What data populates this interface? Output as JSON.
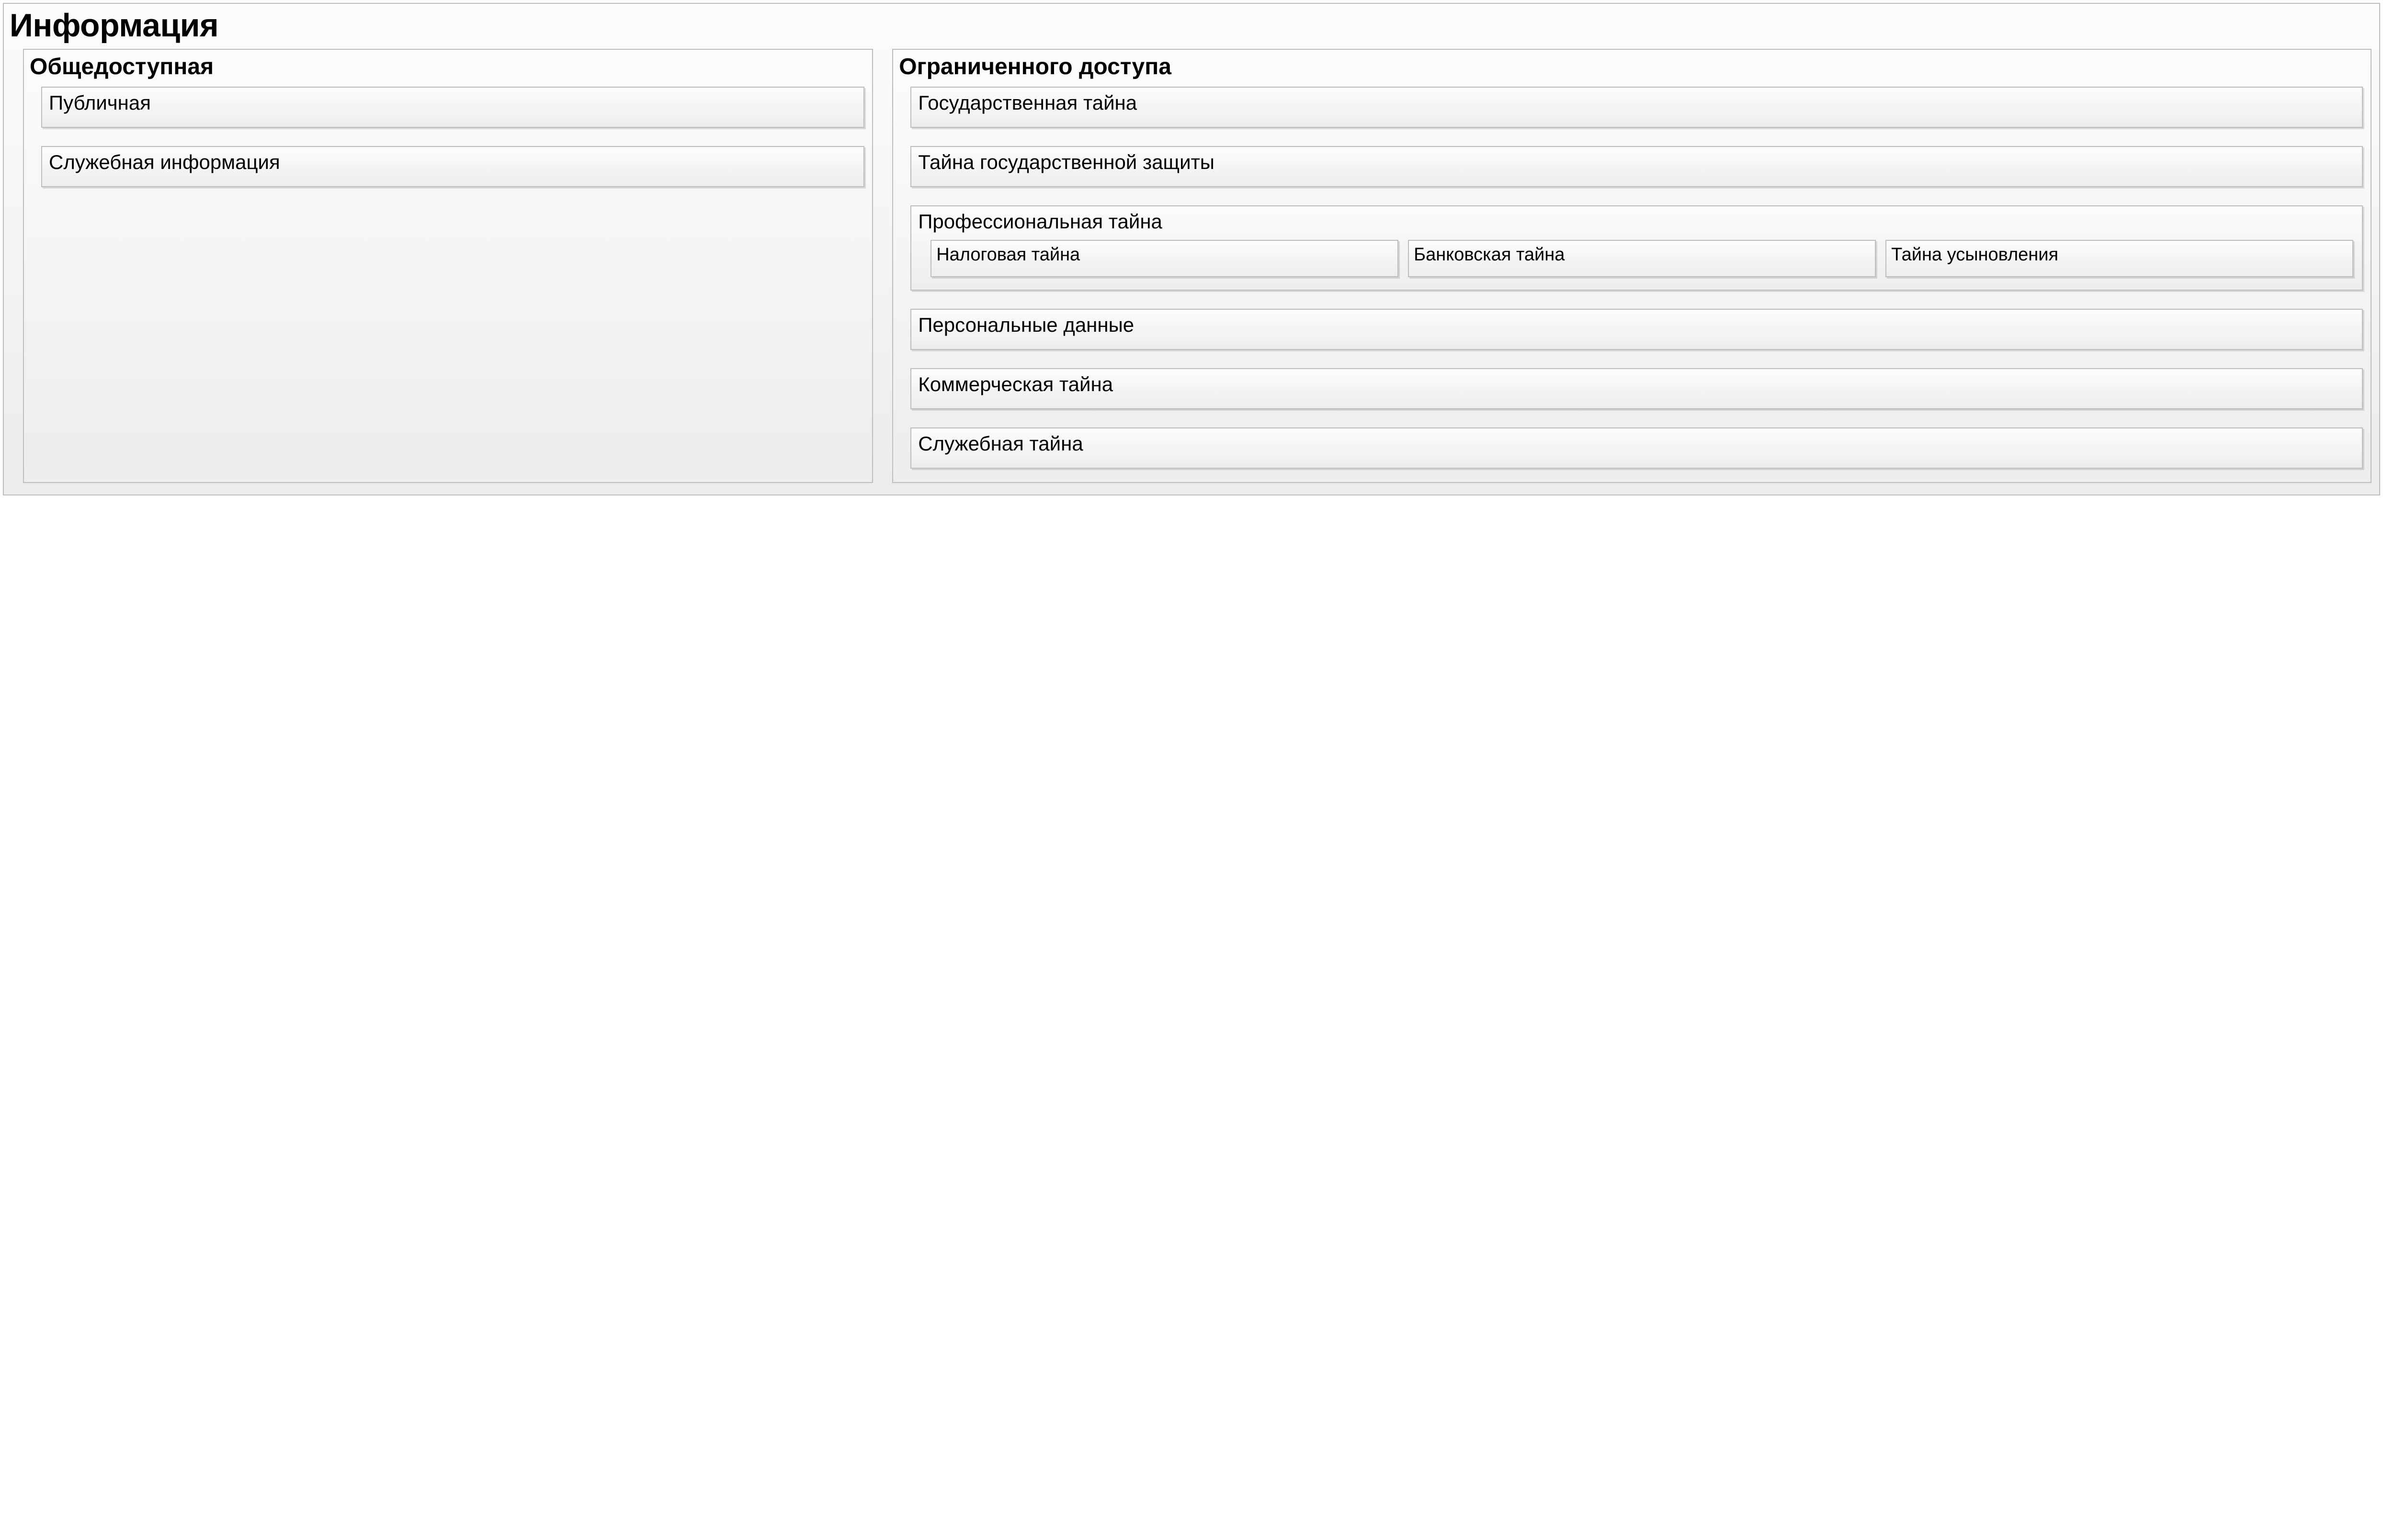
{
  "root": {
    "title": "Информация"
  },
  "left": {
    "title": "Общедоступная",
    "items": [
      {
        "label": "Публичная"
      },
      {
        "label": "Служебная информация"
      }
    ]
  },
  "right": {
    "title": "Ограниченного доступа",
    "items": [
      {
        "label": "Государственная тайна"
      },
      {
        "label": "Тайна государственной защиты"
      },
      {
        "label": "Профессиональная тайна",
        "children": [
          {
            "label": "Налоговая тайна"
          },
          {
            "label": "Банковская тайна"
          },
          {
            "label": "Тайна усыновления"
          }
        ]
      },
      {
        "label": "Персональные данные"
      },
      {
        "label": "Коммерческая тайна"
      },
      {
        "label": "Служебная тайна"
      }
    ]
  }
}
